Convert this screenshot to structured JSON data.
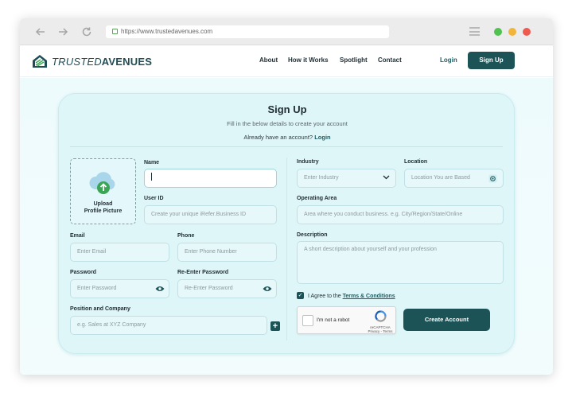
{
  "browser": {
    "url": "https://www.trustedavenues.com"
  },
  "header": {
    "logo_prefix": "TRUSTED",
    "logo_suffix": "AVENUES",
    "menu": [
      "About",
      "How it Works",
      "Spotlight",
      "Contact"
    ],
    "login_label": "Login",
    "signup_label": "Sign Up"
  },
  "form": {
    "title": "Sign Up",
    "subtitle": "Fill in the below details to create your account",
    "already_text": "Already have an account?",
    "login_link": "Login",
    "upload_label_line1": "Upload",
    "upload_label_line2": "Profile Picture",
    "name": {
      "label": "Name",
      "value": ""
    },
    "user_id": {
      "label": "User ID",
      "placeholder": "Create your unique iRefer.Business ID"
    },
    "email": {
      "label": "Email",
      "placeholder": "Enter Email"
    },
    "phone": {
      "label": "Phone",
      "placeholder": "Enter Phone Number"
    },
    "password": {
      "label": "Password",
      "placeholder": "Enter Password"
    },
    "re_password": {
      "label": "Re-Enter Password",
      "placeholder": "Re-Enter Password"
    },
    "position": {
      "label": "Position and Company",
      "placeholder": "e.g. Sales at XYZ Company"
    },
    "industry": {
      "label": "Industry",
      "placeholder": "Enter Industry"
    },
    "location": {
      "label": "Location",
      "placeholder": "Location You are Based"
    },
    "operating_area": {
      "label": "Operating Area",
      "placeholder": "Area where you conduct business. e.g. City/Region/State/Online"
    },
    "description": {
      "label": "Description",
      "placeholder": "A short description about yourself and your profession"
    },
    "agree_text": "I Agree to the",
    "terms_link": "Terms & Conditions",
    "captcha_text": "I'm not a robot",
    "captcha_brand": "reCAPTCHA",
    "captcha_links": "Privacy - Terms",
    "submit_label": "Create Account"
  },
  "colors": {
    "brand": "#1c5357",
    "accent_green": "#3aa655",
    "card_bg": "#dff6f9"
  }
}
